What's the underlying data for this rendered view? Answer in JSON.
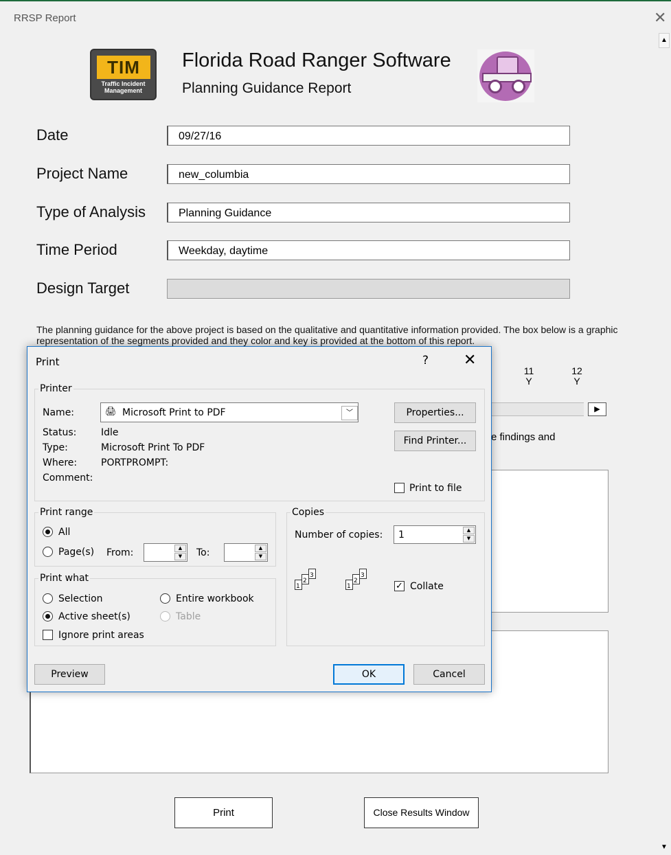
{
  "window": {
    "title": "RRSP Report"
  },
  "header": {
    "logo_text": "TIM",
    "logo_subtext_1": "Traffic Incident",
    "logo_subtext_2": "Management",
    "app_title": "Florida Road Ranger Software",
    "subtitle": "Planning Guidance Report"
  },
  "form": {
    "date_label": "Date",
    "date_value": "09/27/16",
    "project_label": "Project Name",
    "project_value": "new_columbia",
    "analysis_label": "Type of Analysis",
    "analysis_value": "Planning Guidance",
    "period_label": "Time Period",
    "period_value": "Weekday, daytime",
    "target_label": "Design Target",
    "target_value": ""
  },
  "description": "The planning guidance for the above project is based on the qualitative and quantitative information provided.  The box below is a graphic representation of the segments provided and they color and key is provided at the bottom of this report.",
  "segments": [
    {
      "num": "11",
      "flag": "Y"
    },
    {
      "num": "12",
      "flag": "Y"
    }
  ],
  "findings_partial": "e findings and",
  "buttons": {
    "print": "Print",
    "close": "Close Results Window"
  },
  "dialog": {
    "title": "Print",
    "help": "?",
    "printer": {
      "group": "Printer",
      "name_label": "Name:",
      "name_value": "Microsoft Print to PDF",
      "status_label": "Status:",
      "status_value": "Idle",
      "type_label": "Type:",
      "type_value": "Microsoft Print To PDF",
      "where_label": "Where:",
      "where_value": "PORTPROMPT:",
      "comment_label": "Comment:",
      "properties": "Properties...",
      "find": "Find Printer...",
      "print_to_file": "Print to file"
    },
    "range": {
      "group": "Print range",
      "all": "All",
      "pages": "Page(s)",
      "from": "From:",
      "to": "To:"
    },
    "what": {
      "group": "Print what",
      "selection": "Selection",
      "entire": "Entire workbook",
      "active": "Active sheet(s)",
      "table": "Table",
      "ignore": "Ignore print areas"
    },
    "copies": {
      "group": "Copies",
      "number_label": "Number of copies:",
      "number_value": "1",
      "collate": "Collate"
    },
    "preview": "Preview",
    "ok": "OK",
    "cancel": "Cancel"
  }
}
